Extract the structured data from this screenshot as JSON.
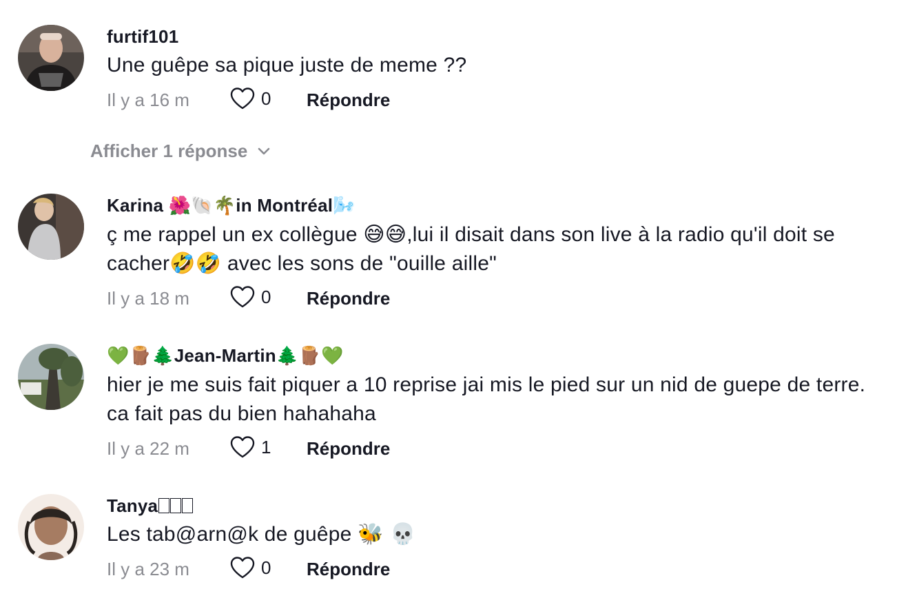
{
  "comments": [
    {
      "username": "furtif101",
      "text": "Une guêpe sa pique juste de meme ??",
      "time": "Il y a 16 m",
      "likes": "0",
      "reply_label": "Répondre",
      "avatar_icon": "avatar-photo"
    },
    {
      "username_prefix": "Karina ",
      "username_emojis": "🌺🐚🌴",
      "username_suffix": "in Montréal",
      "username_trailing_emoji": "🌬️",
      "text_part1": "ç me rappel un ex collègue ",
      "text_emoji1": "😅😅",
      "text_part2": ",lui il disait dans son live à la radio qu'il doit se cacher",
      "text_emoji2": "🤣🤣",
      "text_part3": " avec les sons de \"ouille aille\"",
      "time": "Il y a 18 m",
      "likes": "0",
      "reply_label": "Répondre",
      "avatar_icon": "avatar-photo"
    },
    {
      "username_left_emojis": "💚🪵🌲",
      "username": "Jean-Martin",
      "username_right_emojis": "🌲🪵💚",
      "text": "hier je me suis fait piquer a 10 reprise jai mis le pied sur un nid de guepe de terre. ca fait pas du bien hahahaha",
      "time": "Il y a 22 m",
      "likes": "1",
      "reply_label": "Répondre",
      "avatar_icon": "avatar-photo"
    },
    {
      "username": "Tanya",
      "text": "Les tab@arn@k de guêpe ",
      "text_emojis": "🐝 💀",
      "time": "Il y a 23 m",
      "likes": "0",
      "reply_label": "Répondre",
      "avatar_icon": "avatar-photo"
    }
  ],
  "view_replies_label": "Afficher 1 réponse",
  "colors": {
    "text": "#161823",
    "muted": "#8a8b91",
    "background": "#ffffff"
  }
}
